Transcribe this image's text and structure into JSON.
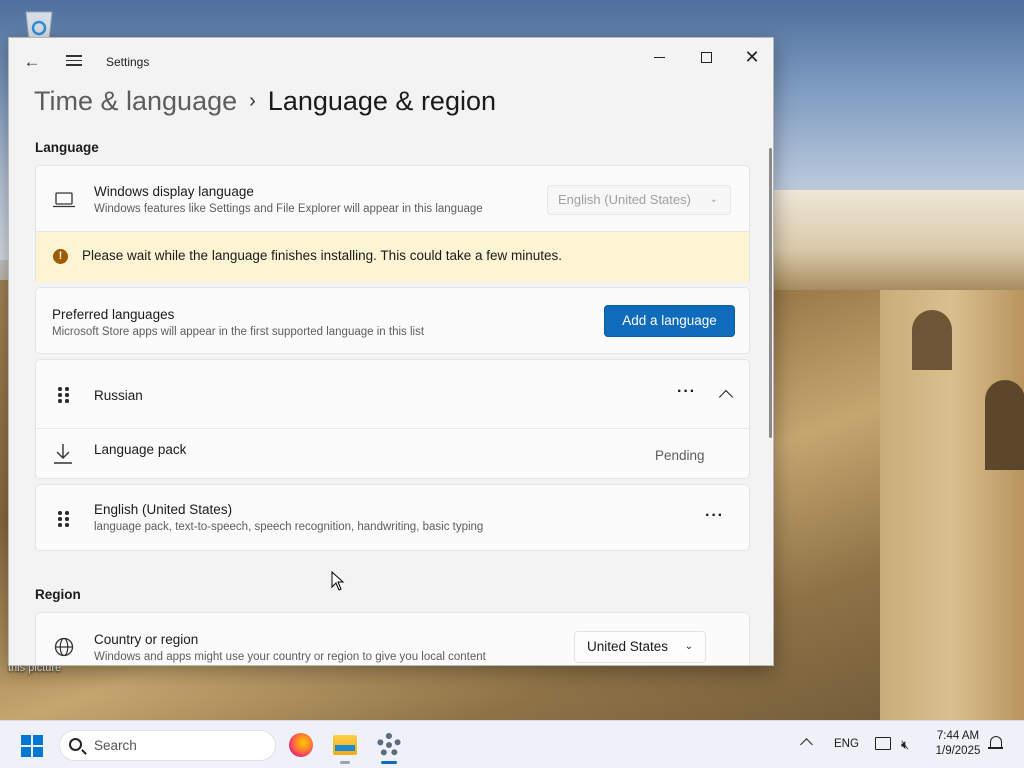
{
  "window": {
    "title": "Settings",
    "breadcrumb_parent": "Time & language",
    "breadcrumb_separator": "›",
    "page_title": "Language & region"
  },
  "language_section": {
    "title": "Language",
    "display_language": {
      "title": "Windows display language",
      "subtitle": "Windows features like Settings and File Explorer will appear in this language",
      "selected": "English (United States)",
      "disabled": true
    },
    "warning": {
      "icon": "warning-icon",
      "text": "Please wait while the language finishes installing. This could take a few minutes."
    },
    "preferred": {
      "title": "Preferred languages",
      "subtitle": "Microsoft Store apps will appear in the first supported language in this list",
      "button": "Add a language"
    },
    "languages": [
      {
        "name": "Russian",
        "expanded": true,
        "sub_item": {
          "label": "Language pack",
          "status": "Pending",
          "progress": 0.05
        }
      },
      {
        "name": "English (United States)",
        "features": "language pack, text-to-speech, speech recognition, handwriting, basic typing"
      }
    ]
  },
  "region_section": {
    "title": "Region",
    "country": {
      "title": "Country or region",
      "subtitle": "Windows and apps might use your country or region to give you local content",
      "selected": "United States"
    }
  },
  "desktop": {
    "label": "this picture"
  },
  "taskbar": {
    "search_placeholder": "Search",
    "apps": [
      "firefox",
      "file-explorer",
      "settings"
    ],
    "tray": {
      "language": "ENG",
      "time": "7:44 AM",
      "date": "1/9/2025"
    }
  },
  "colors": {
    "accent": "#0f6cbd",
    "warning_bg": "#fcf4d2",
    "warning_icon": "#9d5d00"
  }
}
